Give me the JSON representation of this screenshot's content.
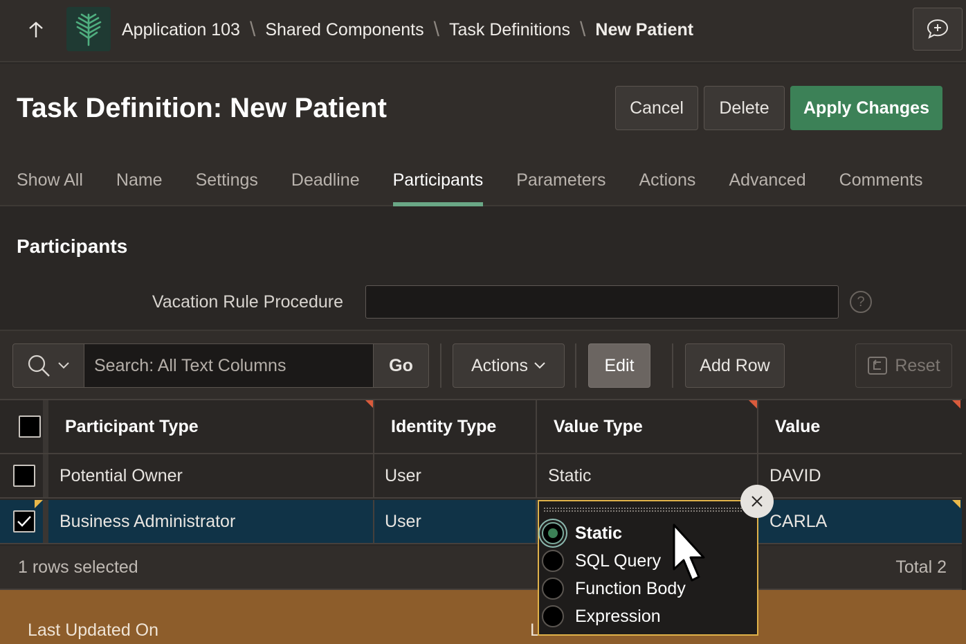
{
  "breadcrumb": {
    "items": [
      "Application 103",
      "Shared Components",
      "Task Definitions"
    ],
    "current": "New Patient",
    "separator": "\\"
  },
  "page": {
    "title": "Task Definition: New Patient"
  },
  "buttons": {
    "cancel": "Cancel",
    "delete": "Delete",
    "apply": "Apply Changes"
  },
  "tabs": [
    {
      "label": "Show All",
      "active": false
    },
    {
      "label": "Name",
      "active": false
    },
    {
      "label": "Settings",
      "active": false
    },
    {
      "label": "Deadline",
      "active": false
    },
    {
      "label": "Participants",
      "active": true
    },
    {
      "label": "Parameters",
      "active": false
    },
    {
      "label": "Actions",
      "active": false
    },
    {
      "label": "Advanced",
      "active": false
    },
    {
      "label": "Comments",
      "active": false
    }
  ],
  "region": {
    "title": "Participants",
    "vacation_label": "Vacation Rule Procedure",
    "vacation_value": "",
    "help": "?"
  },
  "toolbar": {
    "search_placeholder": "Search: All Text Columns",
    "go": "Go",
    "actions": "Actions",
    "edit": "Edit",
    "add_row": "Add Row",
    "reset": "Reset"
  },
  "grid": {
    "columns": [
      "Participant Type",
      "Identity Type",
      "Value Type",
      "Value"
    ],
    "rows": [
      {
        "participant_type": "Potential Owner",
        "identity_type": "User",
        "value_type": "Static",
        "value": "DAVID",
        "selected": false
      },
      {
        "participant_type": "Business Administrator",
        "identity_type": "User",
        "value_type": "",
        "value": "CARLA",
        "selected": true
      }
    ],
    "footer_selected": "1 rows selected",
    "footer_total": "Total 2"
  },
  "popup": {
    "options": [
      "Static",
      "SQL Query",
      "Function Body",
      "Expression"
    ],
    "selected": "Static"
  },
  "bottom": {
    "last_updated_label": "Last Updated On",
    "partial_label": "L"
  },
  "colors": {
    "accent": "#3c8157",
    "selected_row": "#103347",
    "popup_border": "#e0b24a",
    "bottom_strip": "#8d5d2b"
  }
}
